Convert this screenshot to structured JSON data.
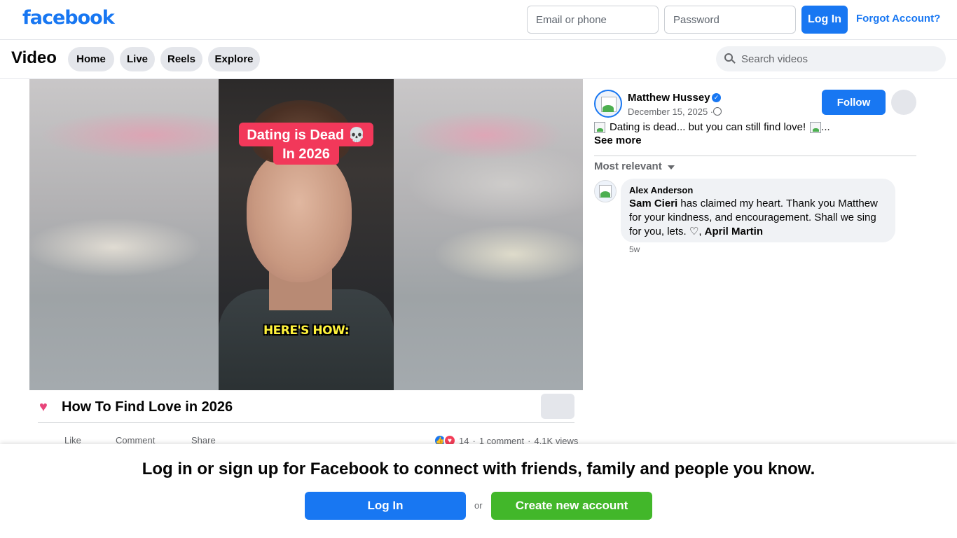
{
  "topbar": {
    "logo": "facebook",
    "email_placeholder": "Email or phone",
    "password_placeholder": "Password",
    "login_label": "Log In",
    "forgot_label": "Forgot Account?"
  },
  "video_nav": {
    "title": "Video",
    "pills": [
      "Home",
      "Live",
      "Reels",
      "Explore"
    ],
    "search_placeholder": "Search videos"
  },
  "video": {
    "caption_line1": "Dating is Dead 💀",
    "caption_line2": "In 2026",
    "caption_bottom": "HERE'S HOW:",
    "title": "How To Find Love in 2026",
    "actions": [
      "Like",
      "Comment",
      "Share"
    ],
    "reaction_count": "14",
    "comments": "1 comment",
    "views": "4.1K views",
    "separator": "·"
  },
  "post": {
    "author": "Matthew Hussey",
    "date": "December 15, 2025 ·",
    "follow_label": "Follow",
    "text": "Dating is dead... but you can still find love!",
    "text_suffix": "...",
    "see_more": "See more",
    "sort_label": "Most relevant"
  },
  "comment": {
    "author": "Alex Anderson",
    "mention1": "Sam Cieri",
    "text": " has claimed my heart. Thank you Matthew for your kindness, and encouragement. Shall we sing for you, lets. ♡, ",
    "mention2": "April Martin",
    "time": "5w"
  },
  "banner": {
    "text": "Log in or sign up for Facebook to connect with friends, family and people you know.",
    "login_label": "Log In",
    "or": "or",
    "create_label": "Create new account"
  },
  "colors": {
    "brand": "#1877f2",
    "green": "#42b72a",
    "caption_red": "#f2385a"
  }
}
